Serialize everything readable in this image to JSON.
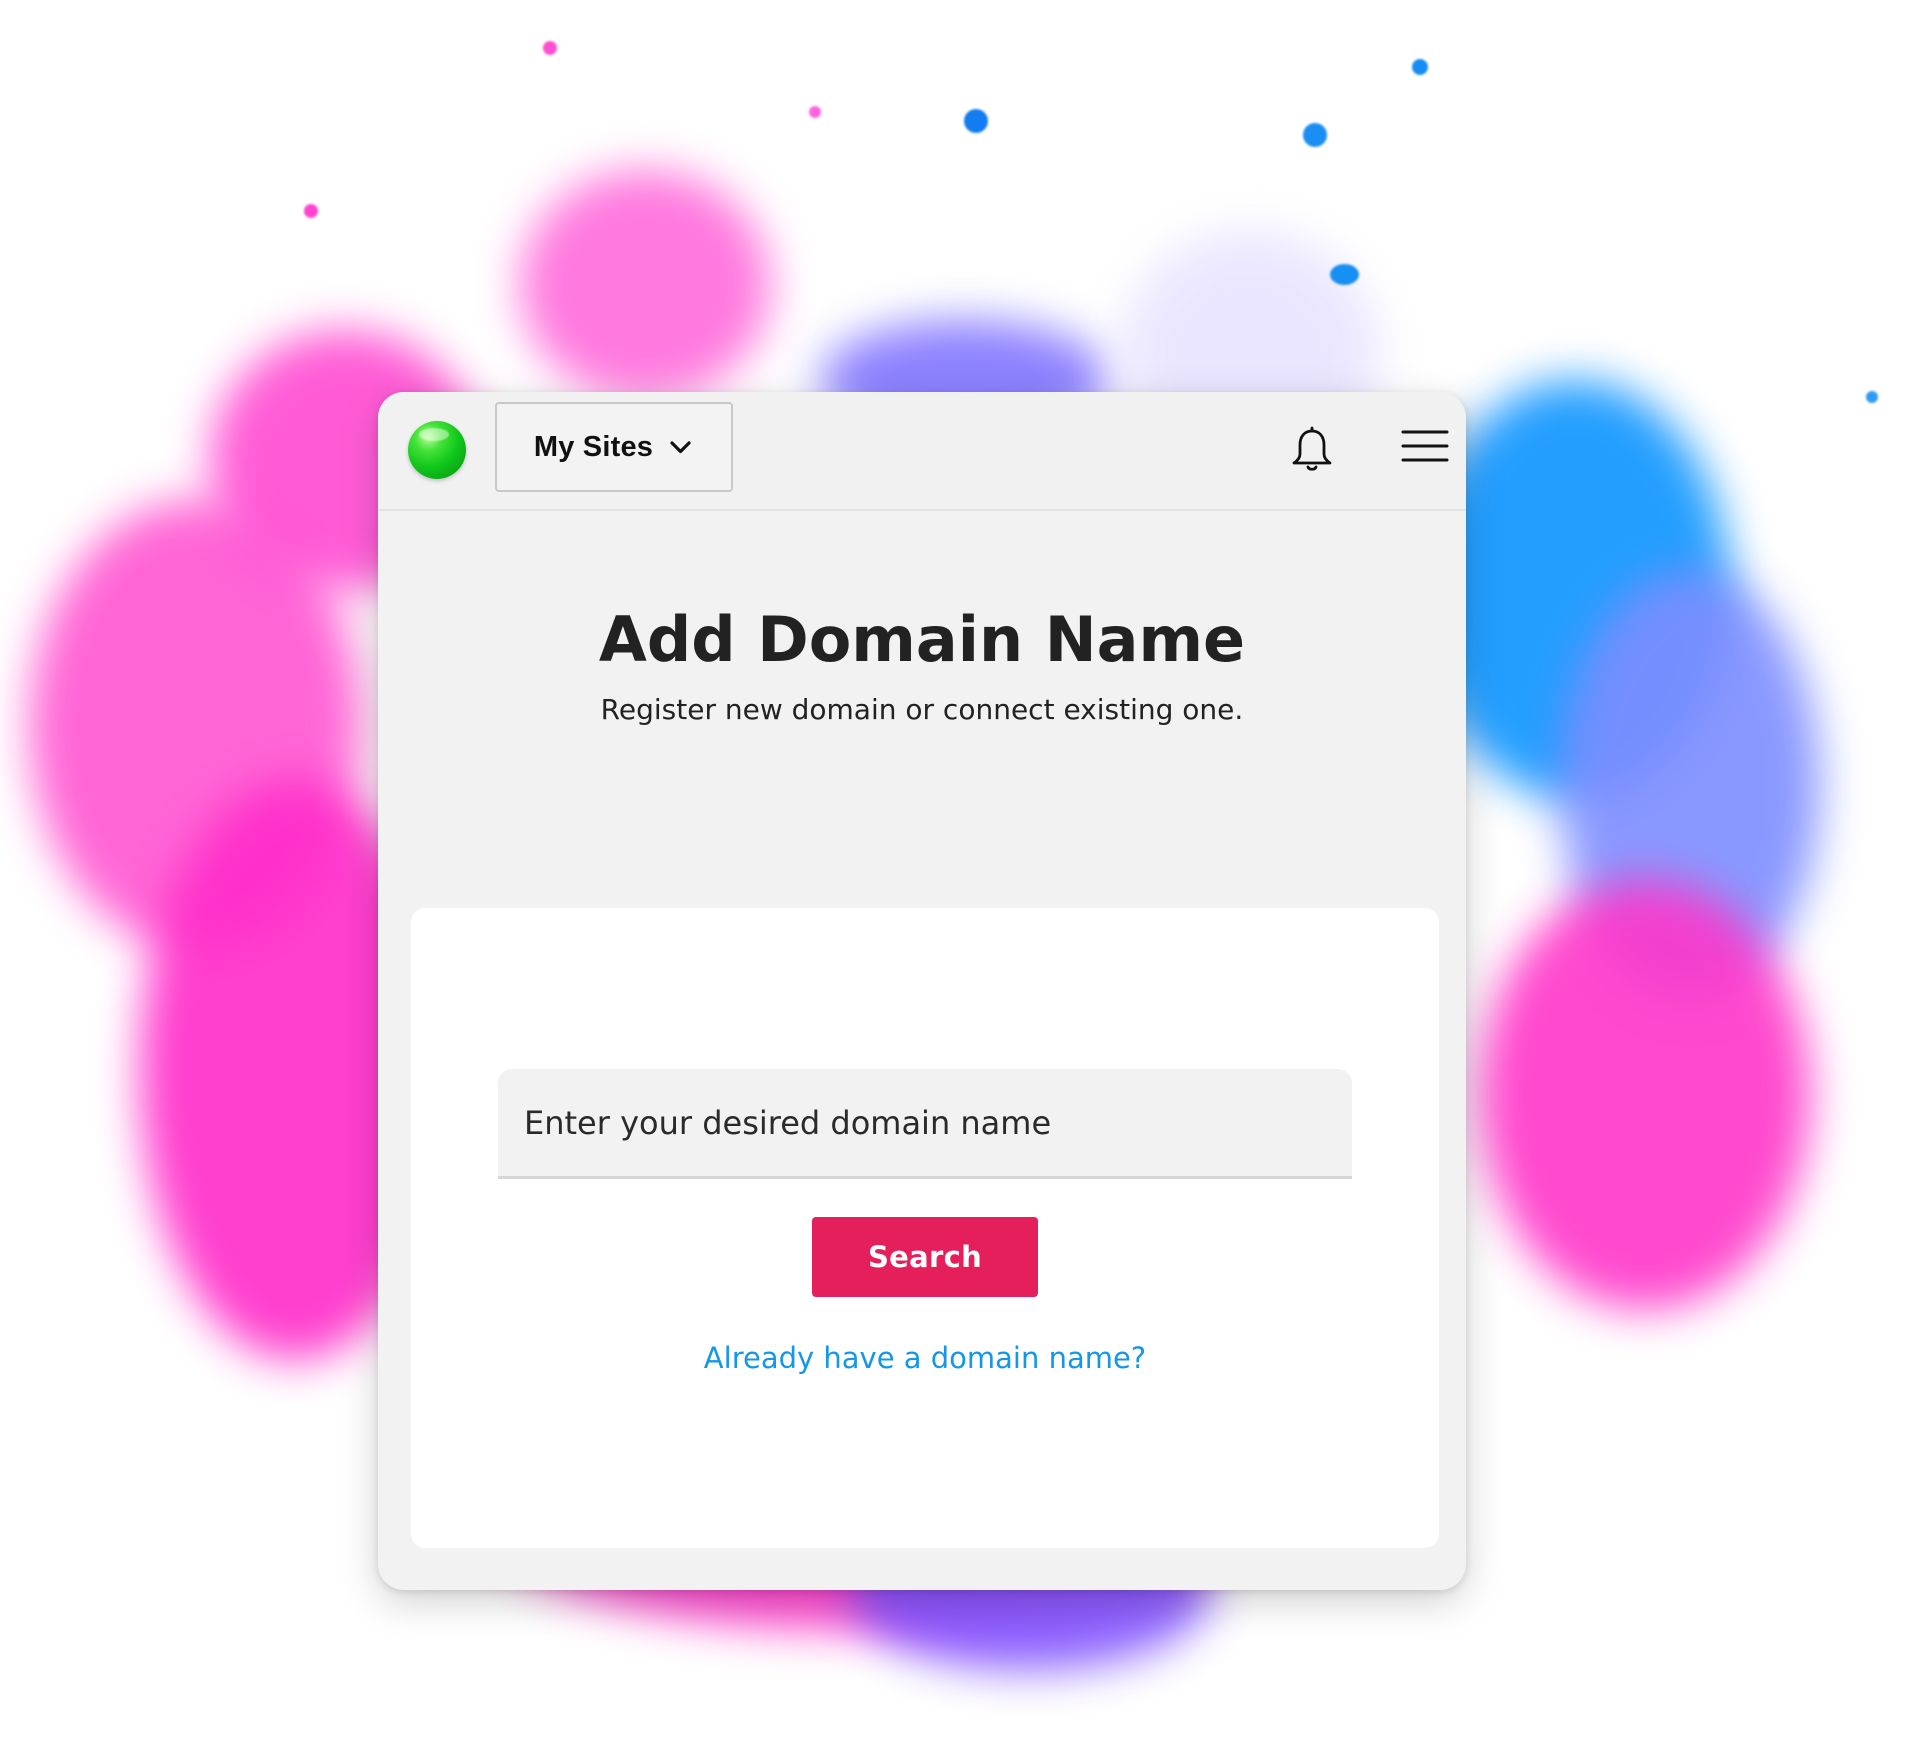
{
  "header": {
    "logo_icon": "green-orb-logo-icon",
    "sites_dropdown": {
      "label": "My Sites",
      "icon": "chevron-down-icon"
    },
    "notifications_icon": "bell-icon",
    "menu_icon": "hamburger-menu-icon"
  },
  "main": {
    "title": "Add Domain Name",
    "subtitle": "Register new domain or connect existing one.",
    "domain_search": {
      "placeholder": "Enter your desired domain name",
      "value": "",
      "button_label": "Search",
      "existing_domain_link": "Already have a domain name?"
    }
  },
  "colors": {
    "primary_button": "#e51f5c",
    "link": "#1597e6",
    "logo": "#10c61a",
    "background_pink": "#ff3cc9",
    "background_blue": "#138dff"
  }
}
